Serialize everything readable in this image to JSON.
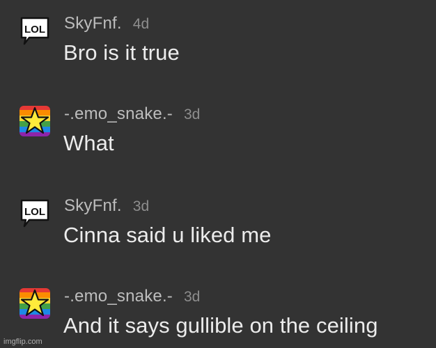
{
  "comments": [
    {
      "avatar_icon": "lol-badge-icon",
      "username": "SkyFnf.",
      "time": "4d",
      "text": "Bro is it true"
    },
    {
      "avatar_icon": "rainbow-star-icon",
      "username": "-.emo_snake.-",
      "time": "3d",
      "text": "What"
    },
    {
      "avatar_icon": "lol-badge-icon",
      "username": "SkyFnf.",
      "time": "3d",
      "text": "Cinna said u liked me"
    },
    {
      "avatar_icon": "rainbow-star-icon",
      "username": "-.emo_snake.-",
      "time": "3d",
      "text": "And it says gullible on the ceiling"
    }
  ],
  "lol_badge_text": "LOL",
  "watermark": "imgflip.com",
  "colors": {
    "background": "#333333",
    "username": "#bdbdbd",
    "timestamp": "#8e8e8e",
    "message": "#ececec"
  }
}
